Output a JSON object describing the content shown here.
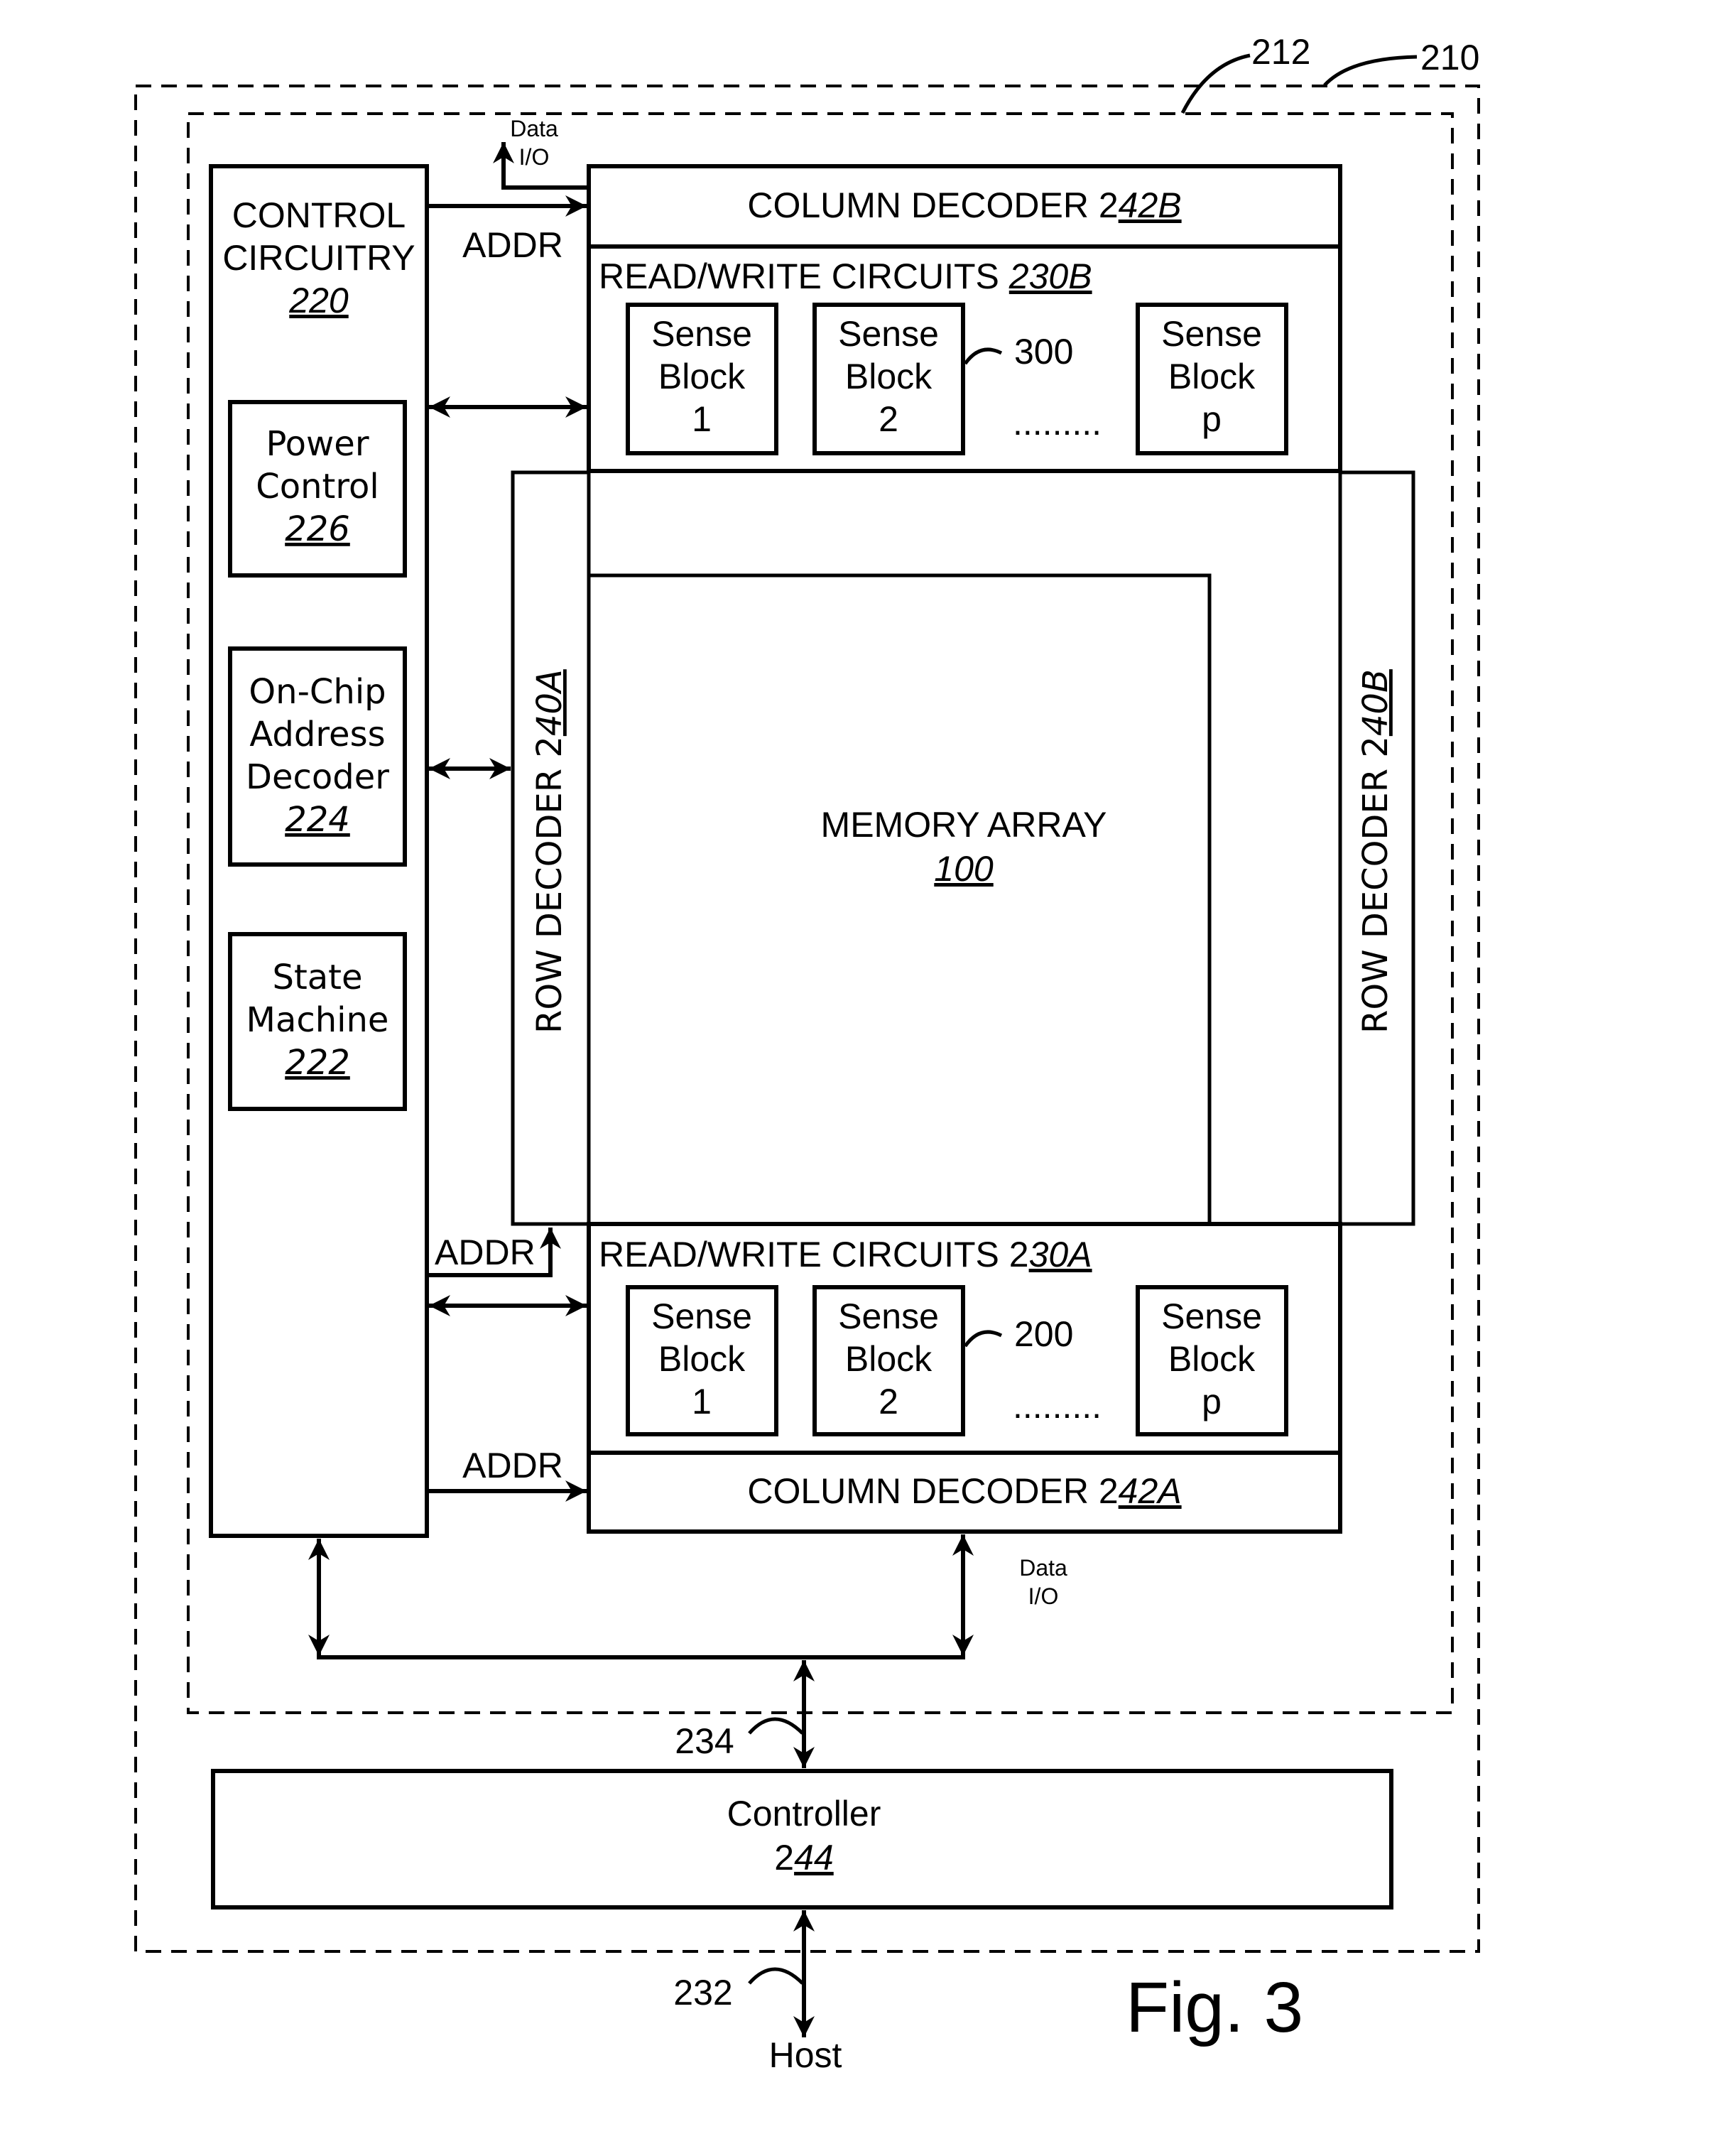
{
  "figure": {
    "caption": "Fig. 3",
    "callouts": {
      "outer_system": "210",
      "memory_die": "212",
      "sense_blocks_top": "300",
      "sense_blocks_bottom": "200",
      "die_bus": "234",
      "host_bus": "232"
    }
  },
  "control_circuitry": {
    "line1": "CONTROL",
    "line2": "CIRCUITRY",
    "ref": "220",
    "power_control": {
      "line1": "Power",
      "line2": "Control",
      "ref": "226"
    },
    "address_decoder": {
      "line1": "On-Chip",
      "line2": "Address",
      "line3": "Decoder",
      "ref": "224"
    },
    "state_machine": {
      "line1": "State",
      "line2": "Machine",
      "ref": "222"
    }
  },
  "column_decoder_top": {
    "label": "COLUMN DECODER 2",
    "ref": "42B"
  },
  "column_decoder_bottom": {
    "label": "COLUMN DECODER 2",
    "ref": "42A"
  },
  "rw_circuits_top": {
    "label": "READ/WRITE CIRCUITS ",
    "ref": "230B"
  },
  "rw_circuits_bottom": {
    "label": "READ/WRITE CIRCUITS 2",
    "ref": "30A"
  },
  "sense_blocks": [
    {
      "line1": "Sense",
      "line2": "Block",
      "line3": "1"
    },
    {
      "line1": "Sense",
      "line2": "Block",
      "line3": "2"
    },
    {
      "line1": "Sense",
      "line2": "Block",
      "line3": "p"
    }
  ],
  "ellipsis": ".........",
  "row_decoder_left": {
    "label": "ROW DECODER 2",
    "ref": "40A"
  },
  "row_decoder_right": {
    "label": "ROW DECODER 2",
    "ref": "40B"
  },
  "memory_array": {
    "label": "MEMORY ARRAY",
    "ref": "100"
  },
  "signals": {
    "addr": "ADDR",
    "data_line1": "Data",
    "data_line2": "I/O"
  },
  "controller": {
    "label": "Controller",
    "prefix": "2",
    "ref": "44"
  },
  "host": "Host"
}
